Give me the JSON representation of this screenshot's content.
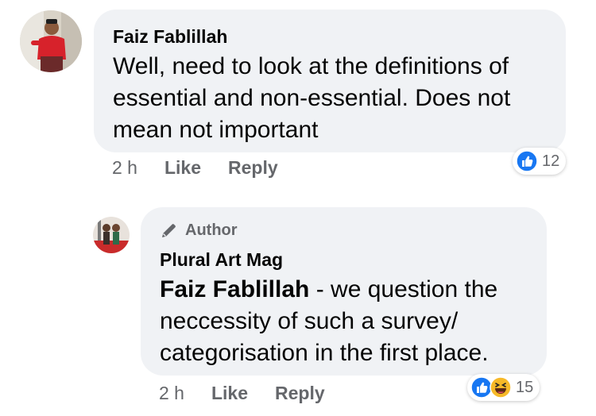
{
  "comments": [
    {
      "author": "Faiz Fablillah",
      "text": "Well, need to look at the definitions of essential and non-essential. Does not mean not important",
      "time": "2 h",
      "like_label": "Like",
      "reply_label": "Reply",
      "reaction_count": "12",
      "reactions": [
        "like-icon"
      ]
    },
    {
      "badge": "Author",
      "author": "Plural Art Mag",
      "tagged_name": "Faiz Fablillah",
      "text": " - we question the neccessity of such a survey/ categorisation in the first place.",
      "time": "2 h",
      "like_label": "Like",
      "reply_label": "Reply",
      "reaction_count": "15",
      "reactions": [
        "like-icon",
        "haha-icon"
      ]
    }
  ],
  "colors": {
    "bubble": "#f0f2f5",
    "secondary_text": "#65676b",
    "like_blue": "#1877f2",
    "haha_yellow": "#f7b928"
  }
}
